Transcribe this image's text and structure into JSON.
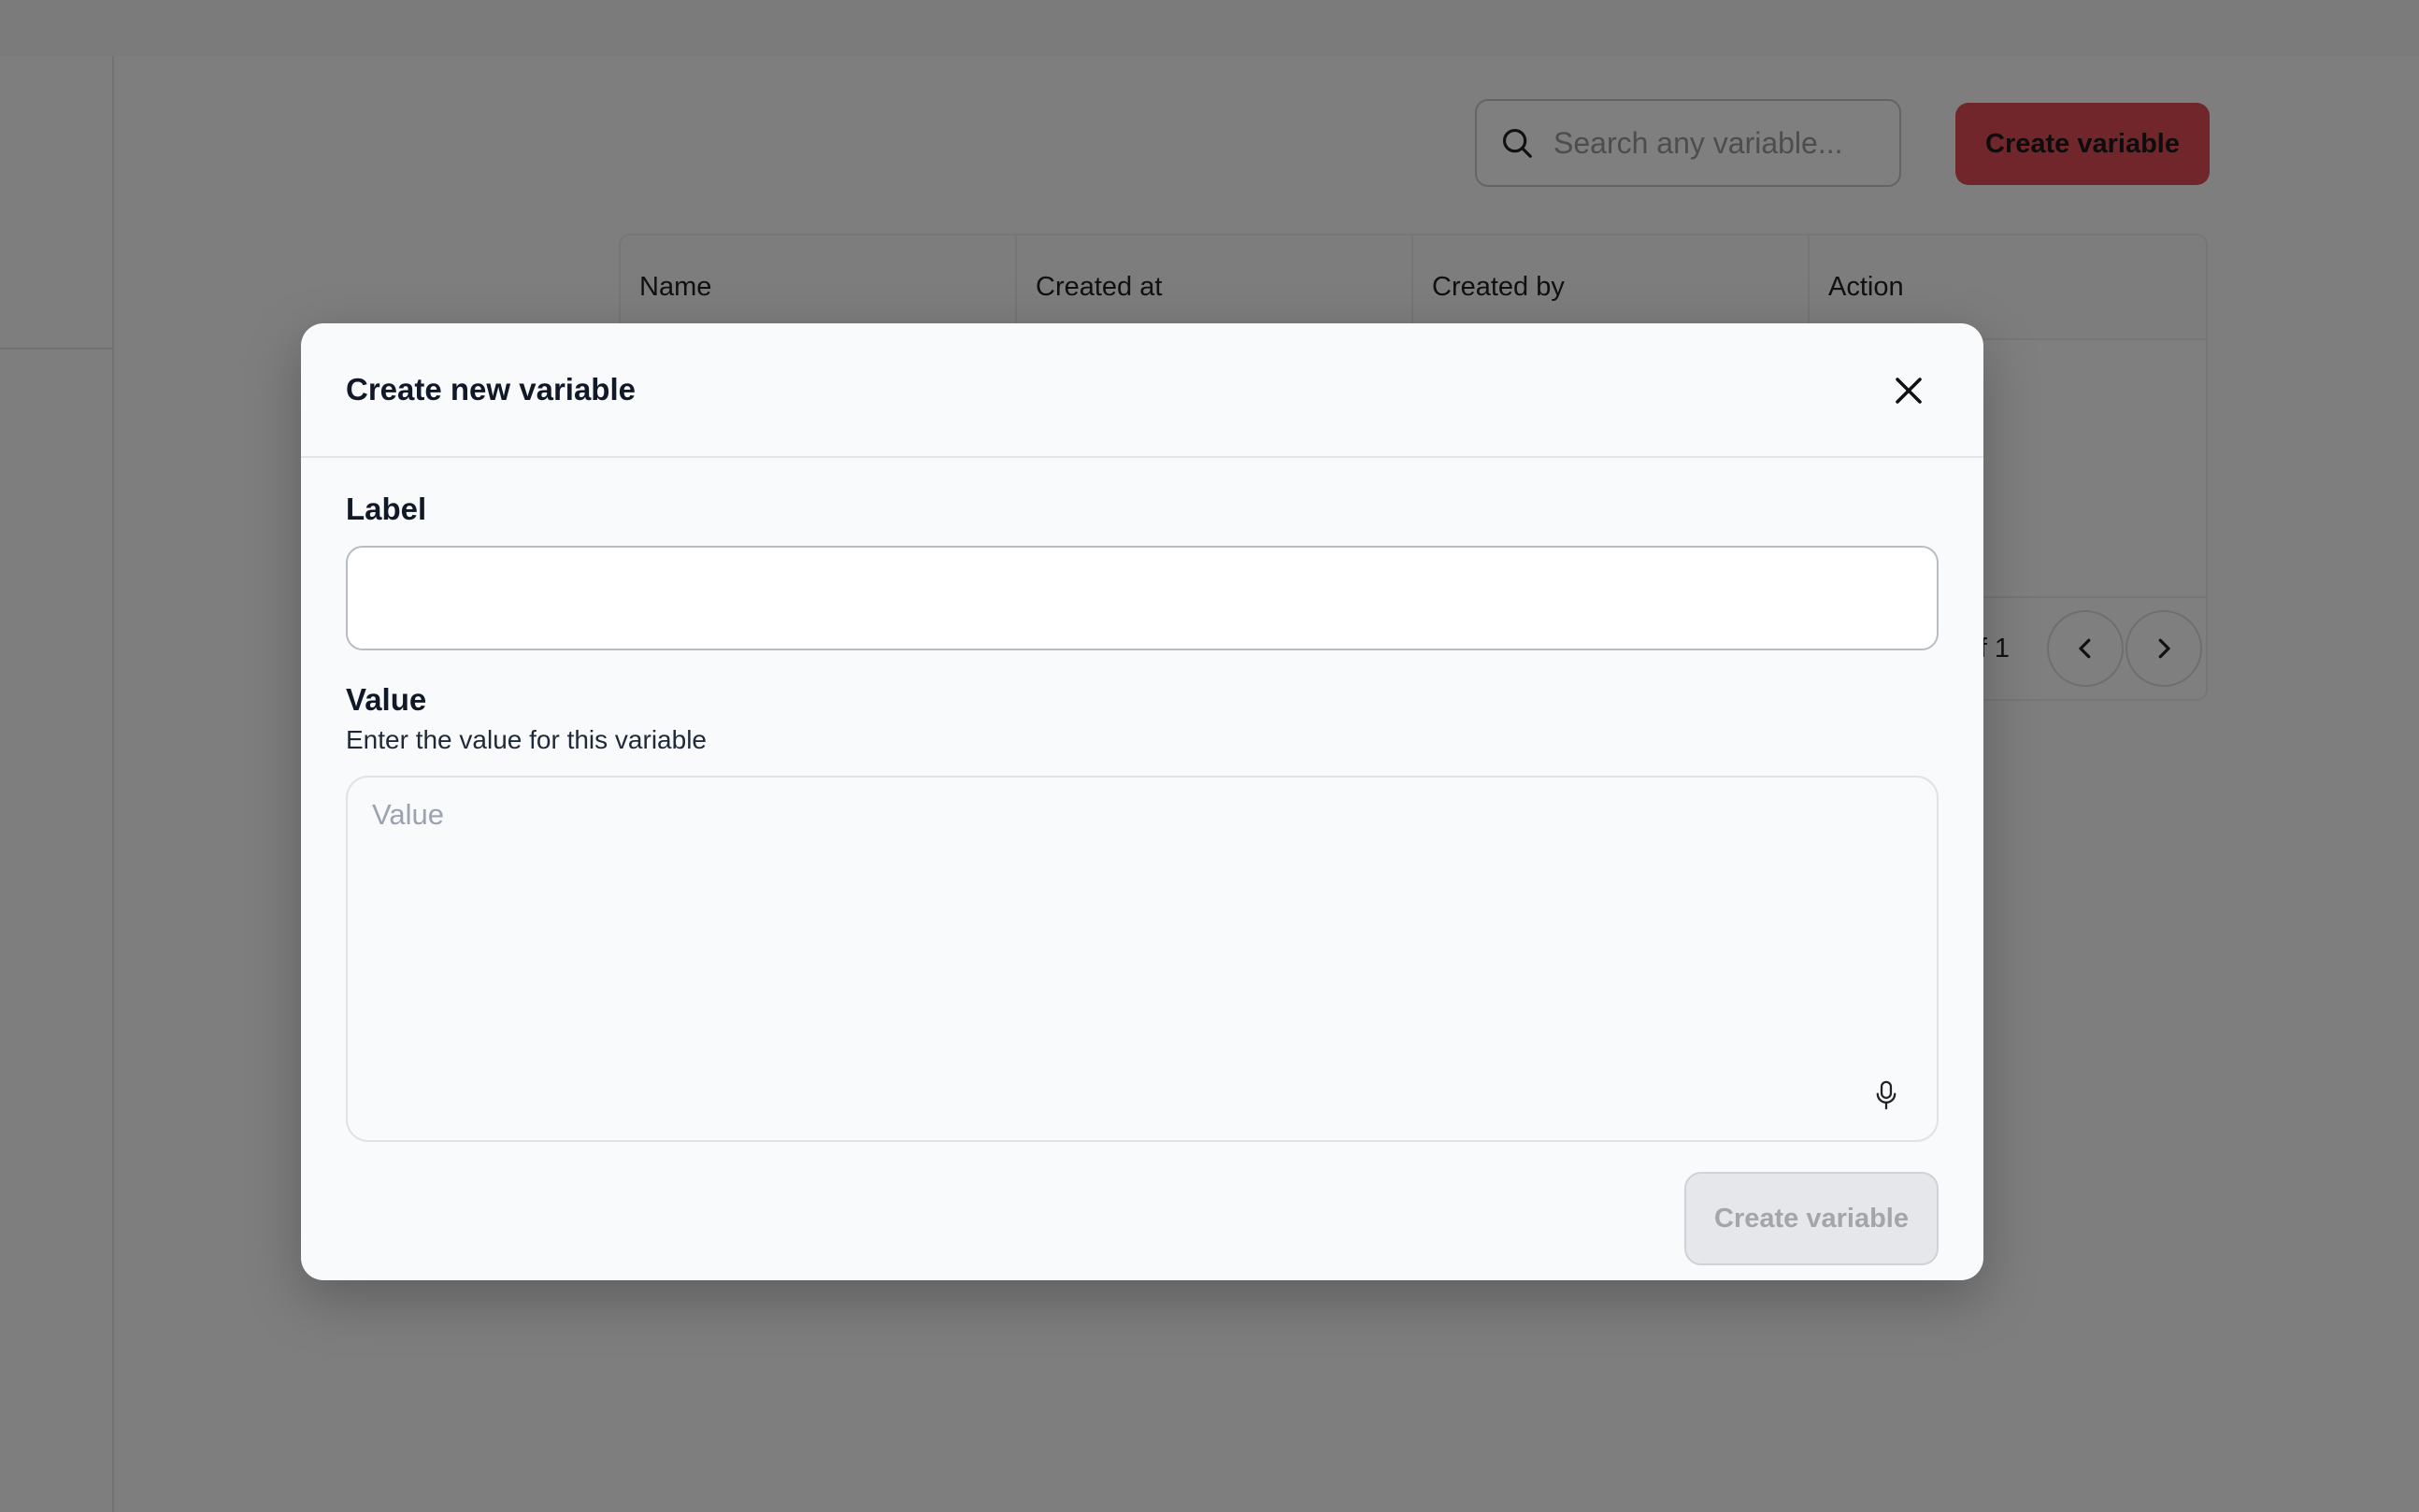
{
  "background": {
    "search": {
      "placeholder": "Search any variable..."
    },
    "create_button_label": "Create variable",
    "table": {
      "columns": [
        "Name",
        "Created at",
        "Created by",
        "Action"
      ],
      "pagination_text": "f 1"
    }
  },
  "modal": {
    "title": "Create new variable",
    "label_field": {
      "label": "Label",
      "value": ""
    },
    "value_field": {
      "label": "Value",
      "help_text": "Enter the value for this variable",
      "placeholder": "Value"
    },
    "submit_label": "Create variable"
  },
  "icons": {
    "search": "search-icon",
    "close": "close-icon",
    "mic": "microphone-icon",
    "prev": "chevron-left-icon",
    "next": "chevron-right-icon"
  },
  "colors": {
    "primary": "#e04d55",
    "overlay": "rgba(0,0,0,0.5)",
    "modal_bg": "#f8fafc",
    "disabled_button_bg": "#e5e7ea"
  }
}
